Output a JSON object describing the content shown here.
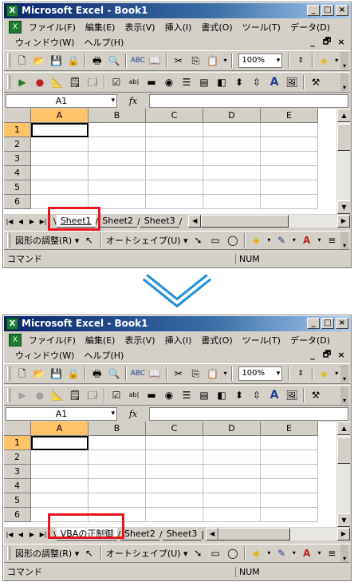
{
  "top": {
    "title": "Microsoft Excel - Book1",
    "sheets": [
      "Sheet1",
      "Sheet2",
      "Sheet3"
    ]
  },
  "bottom": {
    "title": "Microsoft Excel - Book1",
    "sheets": [
      "VBAの正制御",
      "Sheet2",
      "Sheet3"
    ]
  },
  "caption_buttons": [
    "_",
    "□",
    "×"
  ],
  "menu": {
    "row1": [
      "ファイル(F)",
      "編集(E)",
      "表示(V)",
      "挿入(I)",
      "書式(O)",
      "ツール(T)",
      "データ(D)"
    ],
    "row2": [
      "ウィンドウ(W)",
      "ヘルプ(H)"
    ],
    "mdi": [
      "_",
      "🗗",
      "×"
    ]
  },
  "zoom": "100%",
  "namebox": "A1",
  "fx": "fx",
  "columns": [
    "A",
    "B",
    "C",
    "D",
    "E"
  ],
  "rows": [
    "1",
    "2",
    "3",
    "4",
    "5",
    "6"
  ],
  "draw": {
    "adjust": "図形の調整(R) ▾",
    "autoshape": "オートシェイプ(U) ▾"
  },
  "status": {
    "command": "コマンド",
    "num": "NUM"
  },
  "colors": {
    "highlight": "#e8141e",
    "arrow": "#1e8fd8",
    "title_start": "#0a246a",
    "active_header": "#ffc36a"
  }
}
